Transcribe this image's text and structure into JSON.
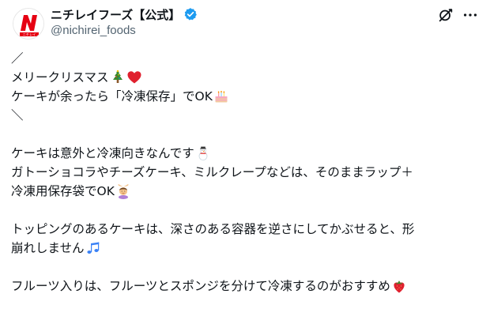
{
  "account": {
    "display_name": "ニチレイフーズ【公式】",
    "handle": "@nichirei_foods",
    "avatar_text": "ニチレイ"
  },
  "icons": {
    "verified": "verified-badge-icon",
    "grok": "grok-icon",
    "more": "more-options-icon"
  },
  "colors": {
    "brand_red": "#e60012",
    "verified_blue": "#1d9bf0",
    "text": "#0f1419",
    "muted": "#536471"
  },
  "post": {
    "lines": [
      "／",
      "メリークリスマス",
      "ケーキが余ったら「冷凍保存」でOK",
      "＼",
      "",
      "ケーキは意外と冷凍向きなんです",
      "ガトーショコラやチーズケーキ、ミルクレープなどは、そのままラップ＋",
      "冷凍用保存袋でOK",
      "",
      "トッピングのあるケーキは、深さのある容器を逆さにしてかぶせると、形",
      "崩れしません",
      "",
      "フルーツ入りは、フルーツとスポンジを分けて冷凍するのがおすすめ"
    ],
    "emojis": {
      "line_1": [
        "christmas-tree-emoji",
        "red-heart-emoji"
      ],
      "line_2": [
        "birthday-cake-emoji"
      ],
      "line_5": [
        "snowman-emoji"
      ],
      "line_7": [
        "woman-gesturing-ok-emoji"
      ],
      "line_10": [
        "musical-notes-emoji"
      ],
      "line_12": [
        "strawberry-emoji"
      ]
    }
  }
}
